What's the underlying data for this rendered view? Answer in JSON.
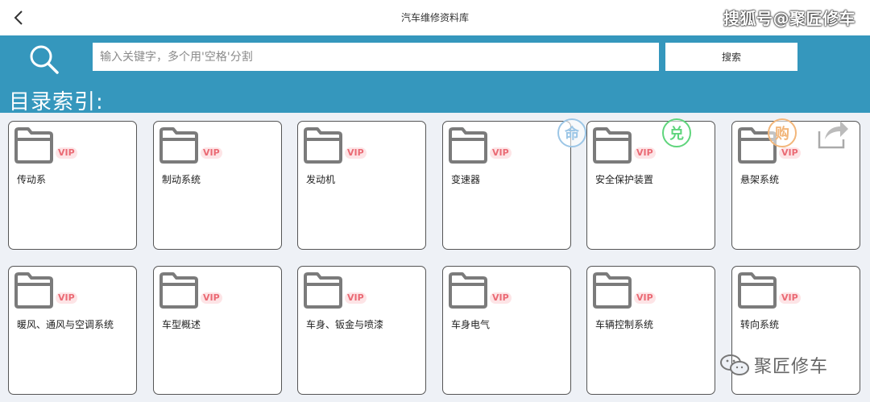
{
  "header": {
    "title": "汽车维修资料库",
    "back_icon": "chevron-left-icon",
    "watermark": "搜狐号@聚匠修车"
  },
  "search": {
    "placeholder": "输入关键字，多个用'空格'分割",
    "value": "",
    "button_label": "搜索",
    "icon": "search-icon"
  },
  "catalog": {
    "title": "目录索引:",
    "badge": "VIP",
    "items": [
      {
        "label": "传动系"
      },
      {
        "label": "制动系统"
      },
      {
        "label": "发动机"
      },
      {
        "label": "变速器"
      },
      {
        "label": "安全保护装置"
      },
      {
        "label": "悬架系统"
      },
      {
        "label": "暖风、通风与空调系统"
      },
      {
        "label": "车型概述"
      },
      {
        "label": "车身、钣金与喷漆"
      },
      {
        "label": "车身电气"
      },
      {
        "label": "车辆控制系统"
      },
      {
        "label": "转向系统"
      }
    ]
  },
  "floating": {
    "home_label": "命",
    "exchange_label": "兑",
    "buy_label": "购",
    "share_icon": "share-icon"
  },
  "footer": {
    "watermark_text": "聚匠修车",
    "watermark_icon": "wechat-icon"
  },
  "colors": {
    "accent": "#3597bd",
    "vip": "#ea6a74",
    "background": "#eef1f6"
  }
}
